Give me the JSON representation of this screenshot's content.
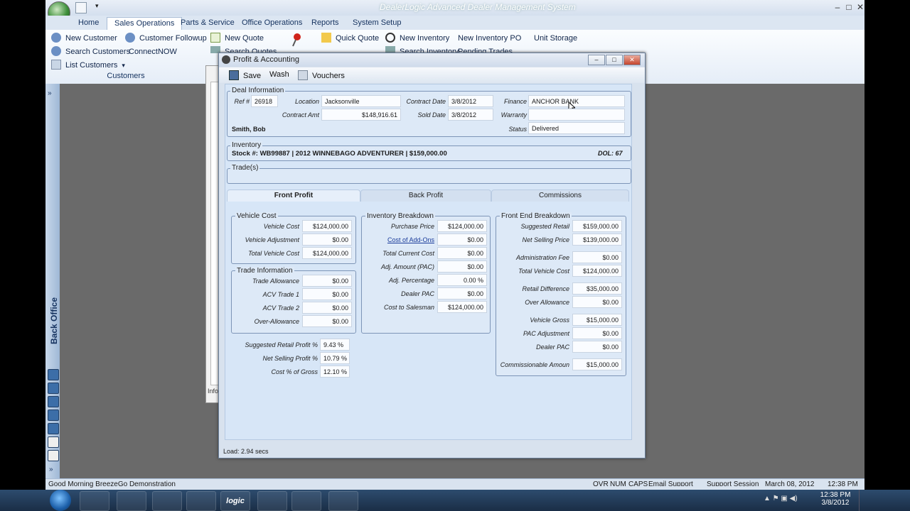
{
  "app": {
    "title": "DealerLogic  Advanced Dealer Management System"
  },
  "ribbon": {
    "tabs": [
      "Home",
      "Sales Operations",
      "Parts & Service",
      "Office Operations",
      "Reports",
      "System Setup"
    ],
    "active_tab": "Sales Operations",
    "buttons": {
      "new_customer": "New Customer",
      "customer_followup": "Customer Followup",
      "new_quote": "New Quote",
      "quick_quote": "Quick Quote",
      "new_inventory": "New Inventory",
      "new_inventory_po": "New Inventory PO",
      "unit_storage": "Unit Storage",
      "search_customers": "Search Customers",
      "connect_now": "ConnectNOW",
      "search_quotes": "Search Quotes",
      "search_inventory": "Search Inventory",
      "pending_trades": "Pending Trades",
      "list_customers": "List Customers"
    },
    "group_label": "Customers"
  },
  "left_rail": {
    "label": "Back Office"
  },
  "statusbar": {
    "greeting": "Good Morning BreezeGo Demonstration",
    "ovr": "OVR",
    "num": "NUM",
    "caps": "CAPS",
    "email_support": "Email Support",
    "support_session": "Support Session",
    "date": "March 08, 2012",
    "time": "12:38 PM"
  },
  "dialog": {
    "title": "Profit & Accounting",
    "toolbar": {
      "save": "Save",
      "wash": "Wash",
      "vouchers": "Vouchers"
    },
    "deal": {
      "legend": "Deal Information",
      "ref_label": "Ref #",
      "ref": "26918",
      "location_label": "Location",
      "location": "Jacksonville",
      "contract_date_label": "Contract Date",
      "contract_date": "3/8/2012",
      "finance_label": "Finance",
      "finance": "ANCHOR BANK",
      "contract_amt_label": "Contract Amt",
      "contract_amt": "$148,916.61",
      "sold_date_label": "Sold Date",
      "sold_date": "3/8/2012",
      "warranty_label": "Warranty",
      "warranty": "",
      "customer": "Smith, Bob",
      "status_label": "Status",
      "status": "Delivered"
    },
    "inventory": {
      "legend": "Inventory",
      "line": "Stock #: WB99887 |  2012 WINNEBAGO ADVENTURER | $159,000.00",
      "dol": "DOL: 67"
    },
    "trades": {
      "legend": "Trade(s)"
    },
    "tabs": [
      "Front Profit",
      "Back Profit",
      "Commissions"
    ],
    "vehicle_cost": {
      "legend": "Vehicle Cost",
      "rows": [
        {
          "label": "Vehicle Cost",
          "value": "$124,000.00"
        },
        {
          "label": "Vehicle Adjustment",
          "value": "$0.00"
        },
        {
          "label": "Total Vehicle Cost",
          "value": "$124,000.00"
        }
      ]
    },
    "trade_info": {
      "legend": "Trade Information",
      "rows": [
        {
          "label": "Trade Allowance",
          "value": "$0.00"
        },
        {
          "label": "ACV Trade 1",
          "value": "$0.00"
        },
        {
          "label": "ACV Trade 2",
          "value": "$0.00"
        },
        {
          "label": "Over-Allowance",
          "value": "$0.00"
        }
      ]
    },
    "summary": {
      "rows": [
        {
          "label": "Suggested Retail Profit %",
          "value": "9.43 %"
        },
        {
          "label": "Net Selling Profit %",
          "value": "10.79 %"
        },
        {
          "label": "Cost % of Gross",
          "value": "12.10 %"
        }
      ]
    },
    "inventory_breakdown": {
      "legend": "Inventory Breakdown",
      "rows": [
        {
          "label": "Purchase Price",
          "value": "$124,000.00"
        },
        {
          "label": "Cost of Add-Ons",
          "value": "$0.00"
        },
        {
          "label": "Total Current Cost",
          "value": "$0.00"
        },
        {
          "label": "Adj. Amount (PAC)",
          "value": "$0.00"
        },
        {
          "label": "Adj. Percentage",
          "value": "0.00 %"
        },
        {
          "label": "Dealer PAC",
          "value": "$0.00"
        },
        {
          "label": "Cost to Salesman",
          "value": "$124,000.00"
        }
      ]
    },
    "front_end": {
      "legend": "Front End Breakdown",
      "rows": [
        {
          "label": "Suggested Retail",
          "value": "$159,000.00"
        },
        {
          "label": "Net Selling Price",
          "value": "$139,000.00"
        },
        {
          "label": "Administration Fee",
          "value": "$0.00"
        },
        {
          "label": "Total Vehicle Cost",
          "value": "$124,000.00"
        },
        {
          "label": "Retail Difference",
          "value": "$35,000.00"
        },
        {
          "label": "Over Allowance",
          "value": "$0.00"
        },
        {
          "label": "Vehicle Gross",
          "value": "$15,000.00"
        },
        {
          "label": "PAC Adjustment",
          "value": "$0.00"
        },
        {
          "label": "Dealer PAC",
          "value": "$0.00"
        },
        {
          "label": "Commissionable Amoun",
          "value": "$15,000.00"
        }
      ]
    },
    "status": "Load: 2.94 secs",
    "bg_label": "Info"
  },
  "taskbar": {
    "time": "12:38 PM",
    "date": "3/8/2012",
    "logic": "logic"
  }
}
